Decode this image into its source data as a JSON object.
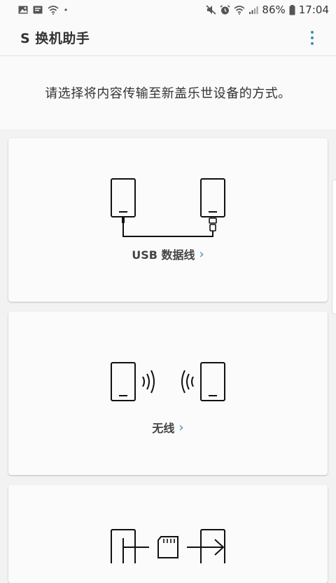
{
  "status_bar": {
    "battery_percent": "86%",
    "time": "17:04",
    "left_icons": [
      "image-icon",
      "message-icon",
      "wifi-icon",
      "dot-icon"
    ],
    "right_icons": [
      "mute-icon",
      "alarm-icon",
      "wifi-icon",
      "signal-icon",
      "battery-icon"
    ]
  },
  "app_bar": {
    "title": "S 换机助手",
    "menu_icon": "more-vert-icon"
  },
  "instruction": "请选择将内容传输至新盖乐世设备的方式。",
  "options": [
    {
      "label": "USB 数据线",
      "icon": "usb-cable-icon"
    },
    {
      "label": "无线",
      "icon": "wireless-icon"
    },
    {
      "label": "",
      "icon": "external-storage-icon"
    }
  ],
  "colors": {
    "accent": "#3a8fb7",
    "background": "#f2f2f2",
    "card": "#fbfbfb"
  }
}
